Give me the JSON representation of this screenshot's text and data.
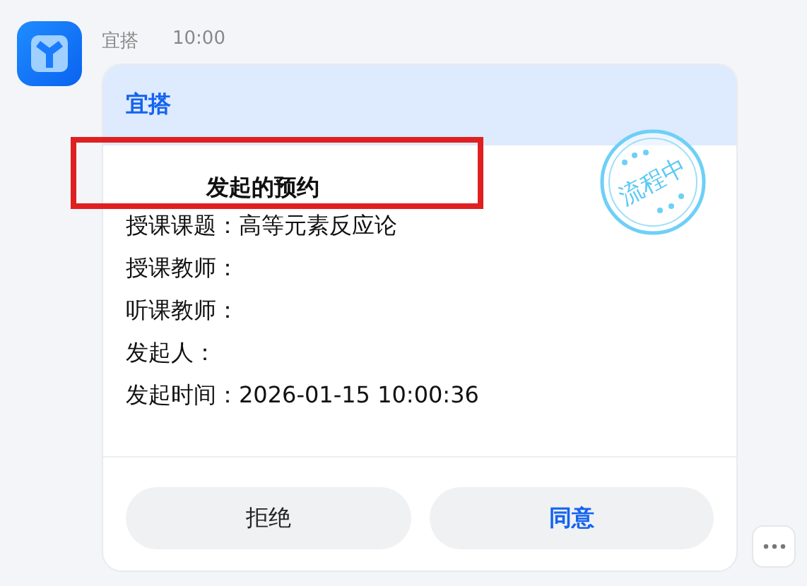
{
  "message": {
    "sender": "宜搭",
    "time": "10:00"
  },
  "card": {
    "header": "宜搭",
    "stamp": "流程中",
    "title": "发起的预约",
    "fields": [
      {
        "label": "授课课题：",
        "value": "高等元素反应论"
      },
      {
        "label": "授课教师："
      },
      {
        "label": "听课教师："
      },
      {
        "label": "发起人："
      },
      {
        "label": "发起时间：",
        "value": "2026-01-15 10:00:36"
      }
    ],
    "buttons": [
      {
        "label": "拒绝",
        "kind": "plain"
      },
      {
        "label": "同意",
        "kind": "primary"
      }
    ]
  }
}
